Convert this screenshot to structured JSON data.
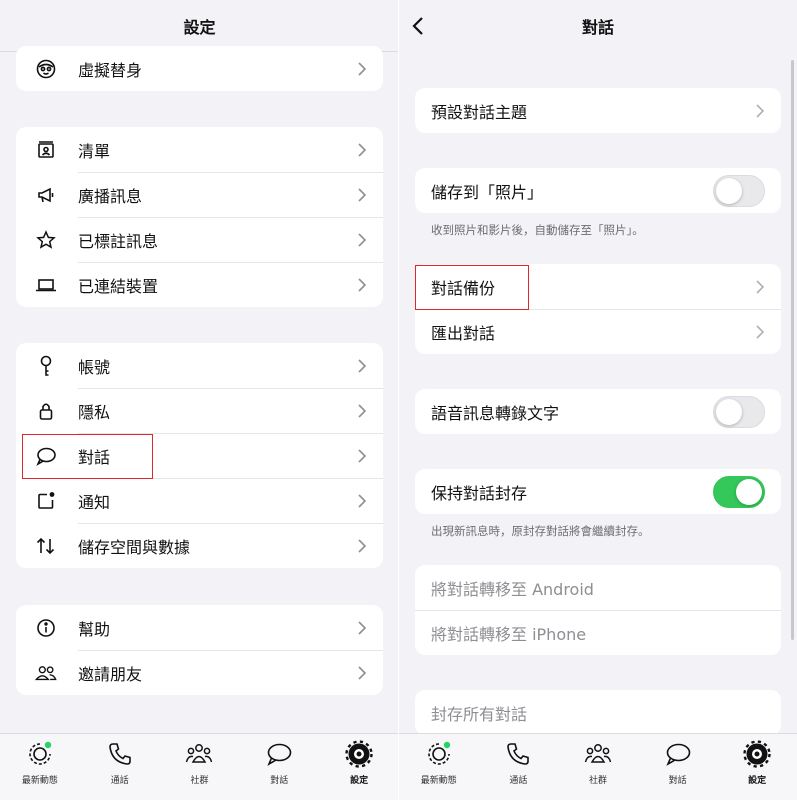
{
  "left": {
    "title": "設定",
    "top_item": "虛擬替身",
    "groups": [
      [
        "清單",
        "廣播訊息",
        "已標註訊息",
        "已連結裝置"
      ],
      [
        "帳號",
        "隱私",
        "對話",
        "通知",
        "儲存空間與數據"
      ],
      [
        "幫助",
        "邀請朋友"
      ]
    ]
  },
  "right": {
    "title": "對話",
    "theme_label": "預設對話主題",
    "save_photos_label": "儲存到「照片」",
    "save_photos_on": false,
    "save_photos_note": "收到照片和影片後，自動儲存至「照片」。",
    "backup_label": "對話備份",
    "export_label": "匯出對話",
    "transcribe_label": "語音訊息轉錄文字",
    "transcribe_on": false,
    "keep_archived_label": "保持對話封存",
    "keep_archived_on": true,
    "keep_archived_note": "出現新訊息時，原封存對話將會繼續封存。",
    "transfer_android": "將對話轉移至 Android",
    "transfer_iphone": "將對話轉移至 iPhone",
    "archive_all": "封存所有對話"
  },
  "tabs": [
    "最新動態",
    "通話",
    "社群",
    "對話",
    "設定"
  ],
  "colors": {
    "toggle_on": "#34c759",
    "highlight": "#e0272d",
    "status_dot": "#25d366"
  }
}
